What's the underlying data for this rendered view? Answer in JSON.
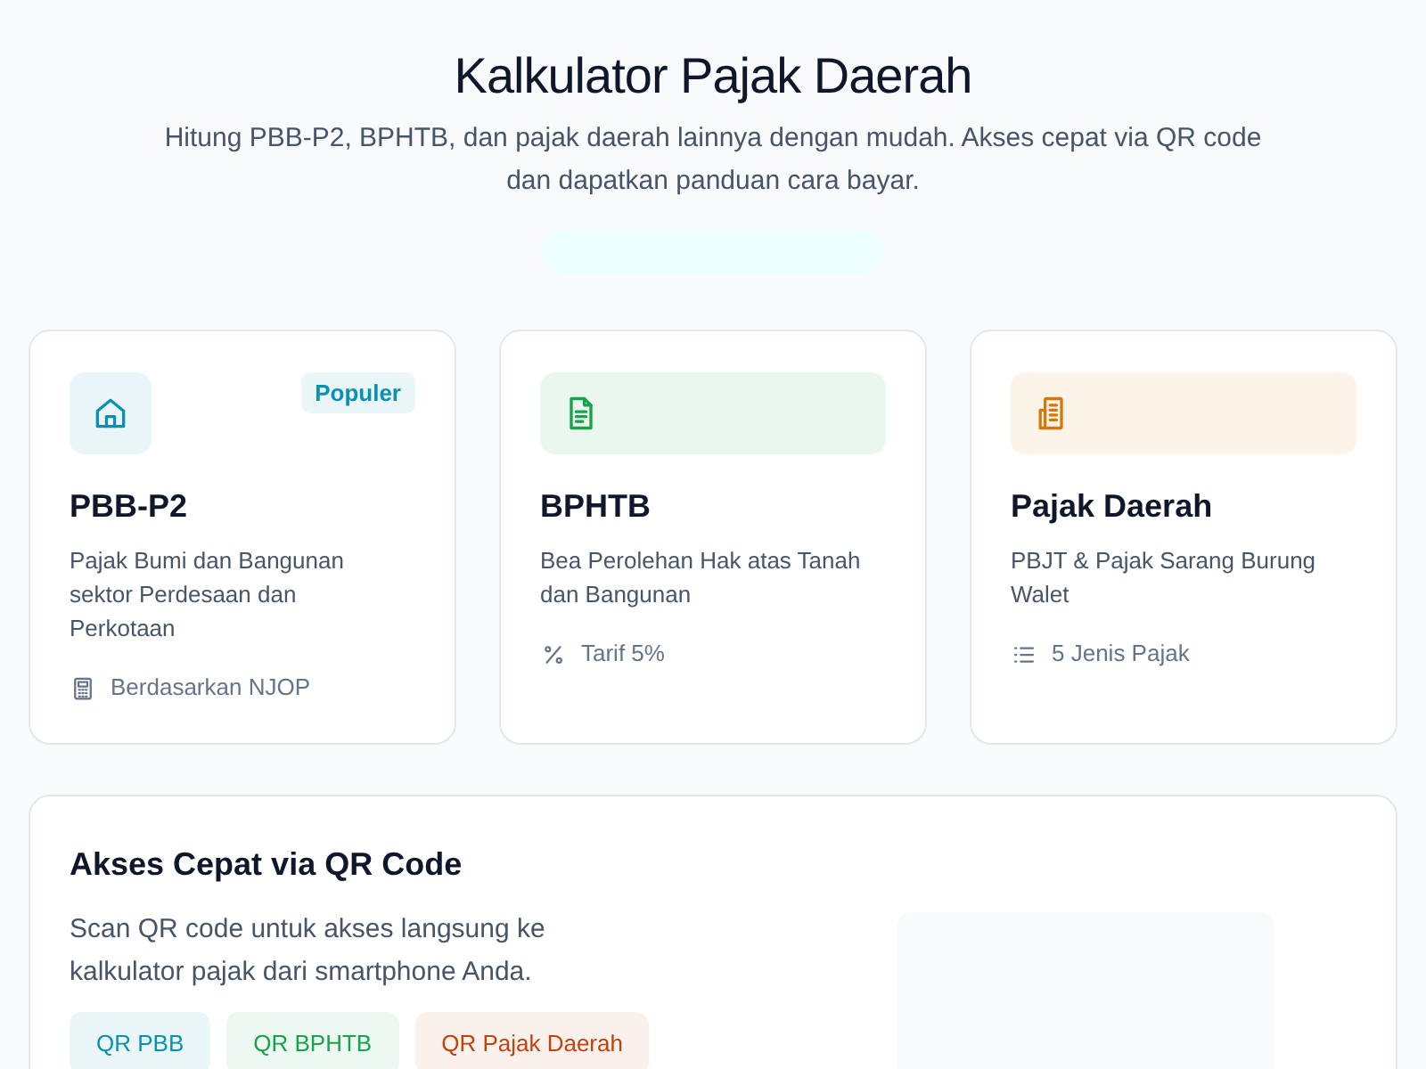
{
  "header": {
    "title": "Kalkulator Pajak Daerah",
    "subtitle": "Hitung PBB-P2, BPHTB, dan pajak daerah lainnya dengan mudah. Akses cepat via QR code dan dapatkan panduan cara bayar."
  },
  "cards": [
    {
      "kind": "property",
      "color": "#0891b2",
      "title": "PBB-P2",
      "badge": "Populer",
      "description": "Pajak Bumi dan Bangunan sektor Perdesaan dan Perkotaan",
      "footer": "Berdasarkan NJOP"
    },
    {
      "kind": "deed",
      "color": "#16a34a",
      "title": "BPHTB",
      "description": "Bea Perolehan Hak atas Tanah dan Bangunan",
      "footer": "Tarif 5%"
    },
    {
      "kind": "regional",
      "color": "#d97706",
      "title": "Pajak Daerah",
      "description": "PBJT & Pajak Sarang Burung Walet",
      "footer": "5 Jenis Pajak"
    }
  ],
  "qr_section": {
    "title": "Akses Cepat via QR Code",
    "description": "Scan QR code untuk akses langsung ke kalkulator pajak dari smartphone Anda.",
    "buttons": [
      {
        "label": "QR PBB",
        "color": "#0891b2"
      },
      {
        "label": "QR BPHTB",
        "color": "#16a34a"
      },
      {
        "label": "QR Pajak Daerah",
        "color": "#c2410c"
      }
    ]
  }
}
